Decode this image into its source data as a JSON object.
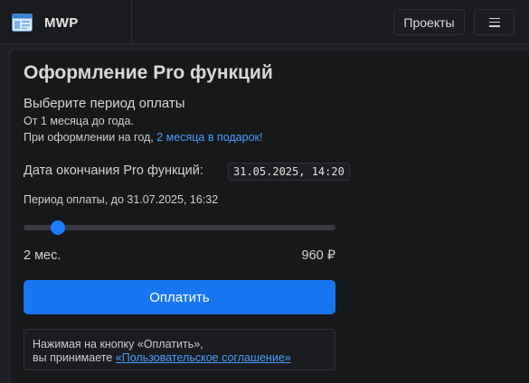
{
  "app": {
    "name": "MWP",
    "icon": "browser-window-icon"
  },
  "nav": {
    "projects_label": "Проекты",
    "menu_icon": "hamburger-menu-icon"
  },
  "page": {
    "title": "Оформление Pro функций",
    "subtitle": "Выберите период оплаты",
    "line1": "От 1 месяца до года.",
    "line2_prefix": "При оформлении на год, ",
    "line2_link": "2 месяца в подарок!",
    "end_label": "Дата окончания Pro функций:",
    "end_value": "31.05.2025, 14:20",
    "period_label": "Период оплаты, до 31.07.2025, 16:32",
    "slider": {
      "min_months": 1,
      "max_months": 12,
      "value_months": 2
    },
    "months_label": "2 мес.",
    "price_label": "960 ₽",
    "pay_label": "Оплатить",
    "agree_line1": "Нажимая на кнопку «Оплатить»,",
    "agree_line2_prefix": "вы принимаете ",
    "agree_link": "«Пользовательское соглашение»"
  },
  "colors": {
    "accent": "#1976f2",
    "link": "#4a9dff",
    "background": "#1e1f22"
  }
}
